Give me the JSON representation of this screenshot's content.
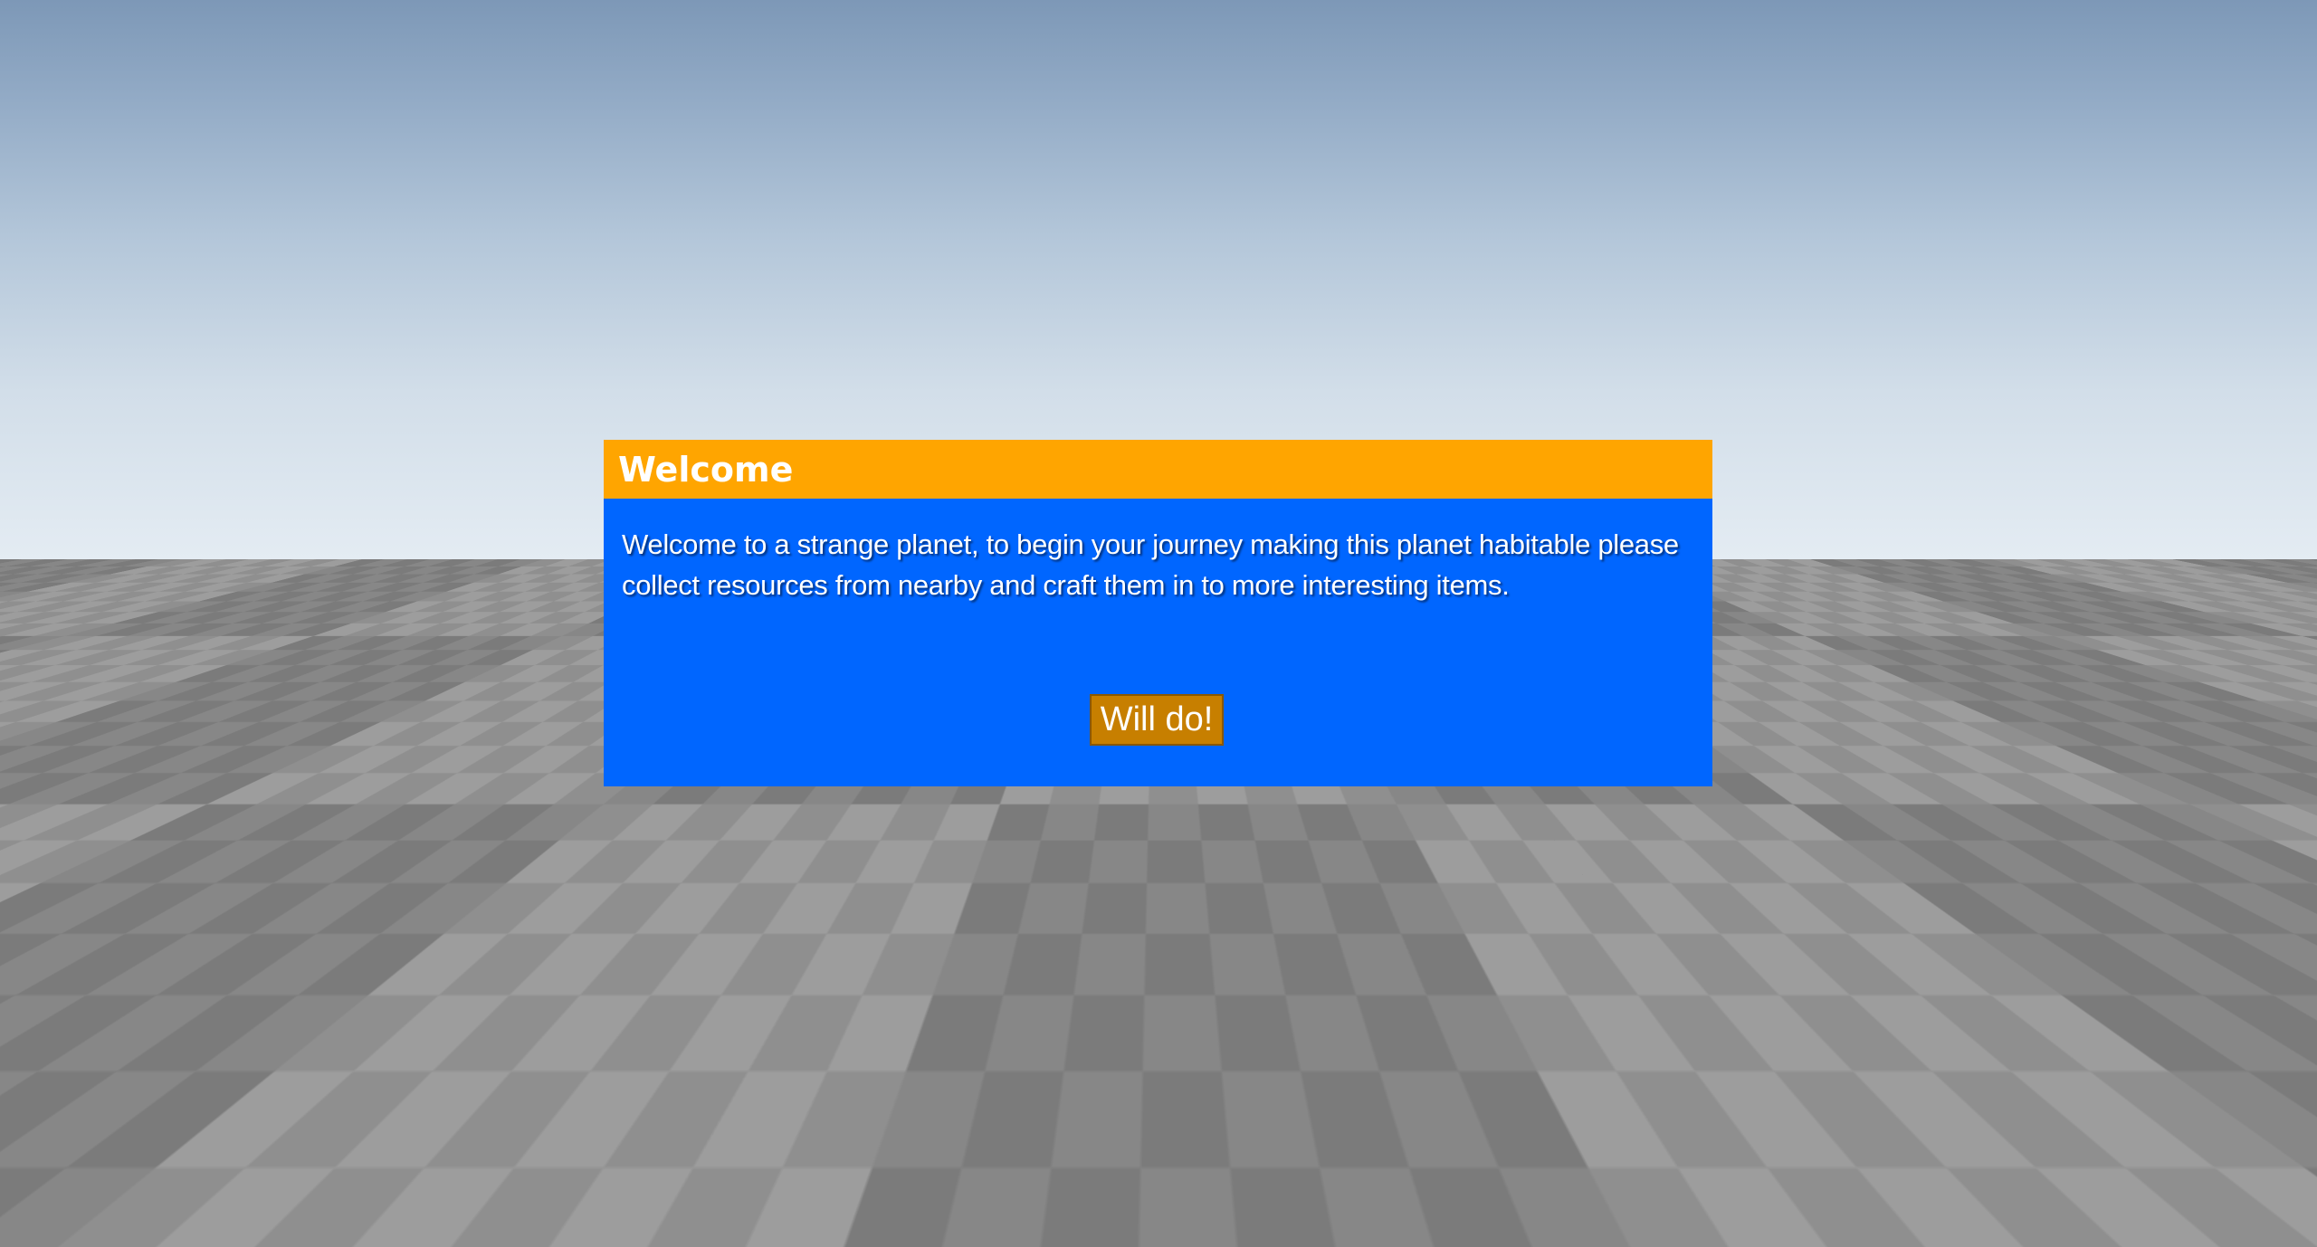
{
  "dialog": {
    "title": "Welcome",
    "message": "Welcome to a strange planet, to begin your journey making this planet habitable please collect resources from nearby and craft them in to more interesting items.",
    "button_label": "Will do!"
  },
  "colors": {
    "header": "#ffa500",
    "panel": "#0066ff",
    "button": "#c77f00",
    "text": "#ffffff"
  }
}
